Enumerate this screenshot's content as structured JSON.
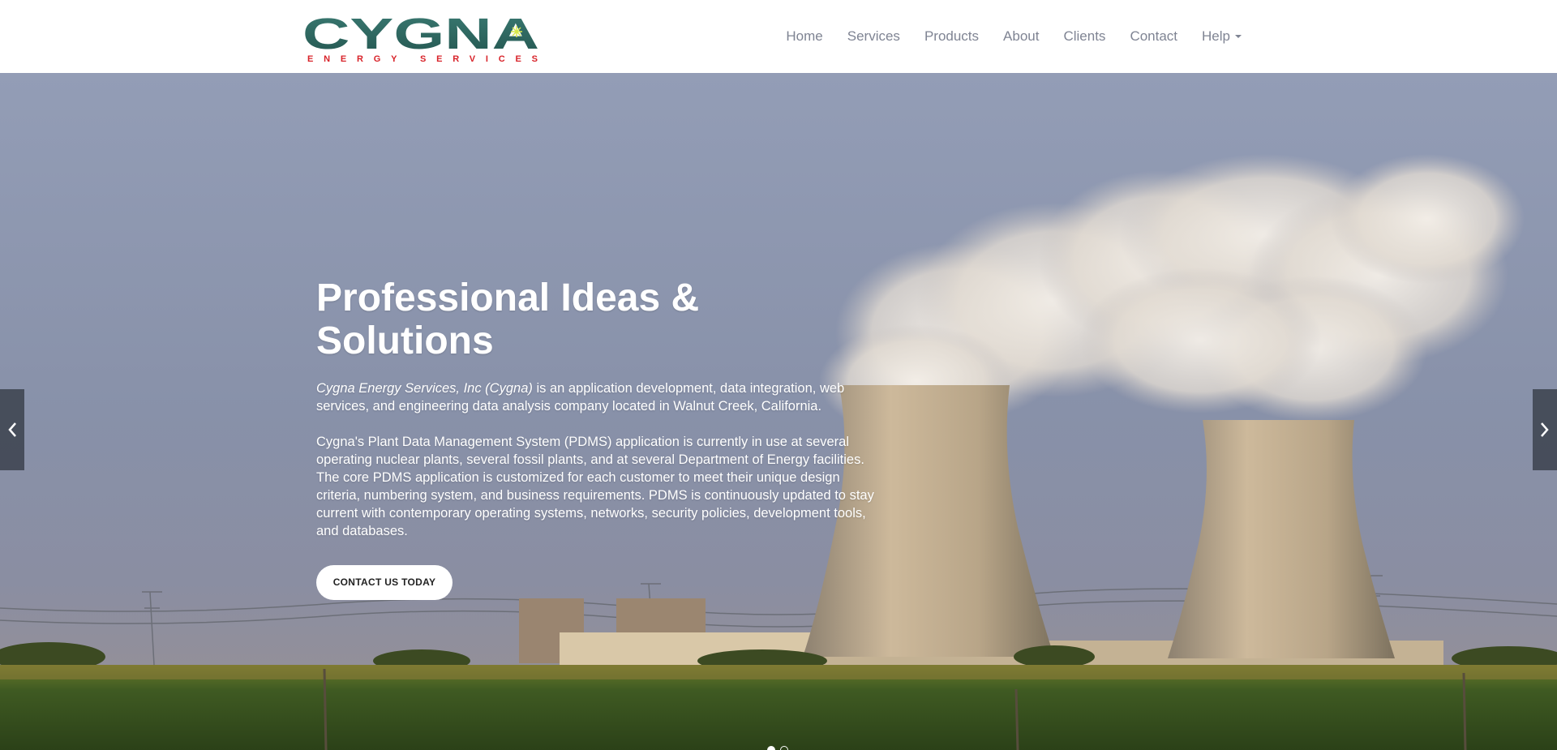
{
  "brand": {
    "logo_text": "CYGNA",
    "logo_subtitle": "ENERGY SERVICES",
    "colors": {
      "logo_primary": "#2f6660",
      "logo_subtitle": "#d8232a",
      "logo_star": "#d7e84a"
    }
  },
  "nav": {
    "items": [
      {
        "label": "Home"
      },
      {
        "label": "Services"
      },
      {
        "label": "Products"
      },
      {
        "label": "About"
      },
      {
        "label": "Clients"
      },
      {
        "label": "Contact"
      },
      {
        "label": "Help",
        "has_dropdown": true
      }
    ]
  },
  "hero": {
    "title": "Professional Ideas & Solutions",
    "intro_italic": "Cygna Energy Services, Inc (Cygna)",
    "intro_rest": " is an application development, data integration, web services, and engineering data analysis company located in Walnut Creek, California.",
    "paragraph2": "Cygna's Plant Data Management System (PDMS) application is currently in use at several operating nuclear plants, several fossil plants, and at several Department of Energy facilities. The core PDMS application is customized for each customer to meet their unique design criteria, numbering system, and business requirements. PDMS is continuously updated to stay current with contemporary operating systems, networks, security policies, development tools, and databases.",
    "cta_label": "CONTACT US TODAY",
    "background_description_icon": "cooling-towers-photo"
  },
  "carousel": {
    "prev_icon": "chevron-left-icon",
    "next_icon": "chevron-right-icon",
    "slide_count": 2,
    "active_slide": 1
  }
}
